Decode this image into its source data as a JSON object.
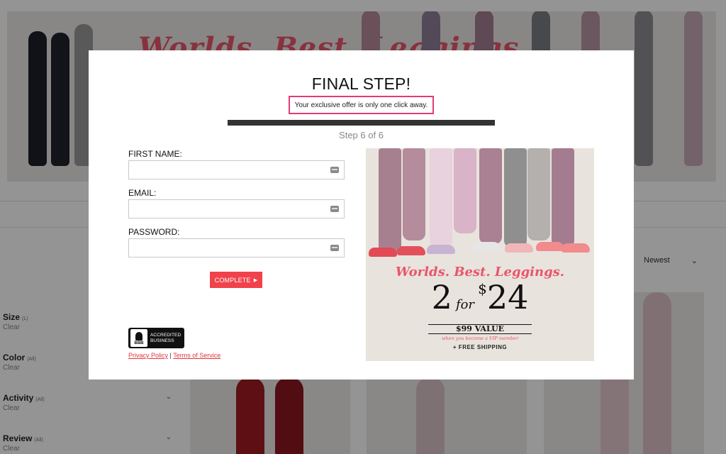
{
  "background": {
    "hero_heading": "Worlds. Best. Leggings.",
    "sort": {
      "selected": "Newest"
    },
    "filters": [
      {
        "title": "Size",
        "count": "(L)",
        "clear": "Clear"
      },
      {
        "title": "Color",
        "count": "(All)",
        "clear": "Clear"
      },
      {
        "title": "Activity",
        "count": "(All)",
        "clear": "Clear"
      },
      {
        "title": "Review",
        "count": "(All)",
        "clear": "Clear"
      }
    ]
  },
  "modal": {
    "title": "FINAL STEP!",
    "subtitle": "Your exclusive offer is only one click away.",
    "progress": {
      "current": 6,
      "total": 6,
      "fraction": 1.0
    },
    "step_label": "Step 6 of 6",
    "fields": {
      "first_name": {
        "label": "FIRST NAME:",
        "value": "",
        "placeholder": ""
      },
      "email": {
        "label": "EMAIL:",
        "value": "",
        "placeholder": ""
      },
      "password": {
        "label": "PASSWORD:",
        "value": "",
        "placeholder": ""
      }
    },
    "complete_button": "COMPLETE",
    "bbb": {
      "letters": "BBB",
      "line1": "ACCREDITED",
      "line2": "BUSINESS"
    },
    "links": {
      "privacy": "Privacy Policy",
      "separator": "|",
      "terms": "Terms of Service"
    },
    "promo": {
      "heading": "Worlds. Best. Leggings.",
      "price_qty": "2",
      "price_for": "for",
      "currency": "$",
      "price_amount": "24",
      "value_text": "$99 VALUE",
      "note": "when you become a VIP member",
      "shipping": "+ FREE SHIPPING"
    }
  },
  "colors": {
    "accent_red": "#f0424b",
    "highlight_pink": "#e23a7a",
    "script_pink": "#e8566b"
  }
}
